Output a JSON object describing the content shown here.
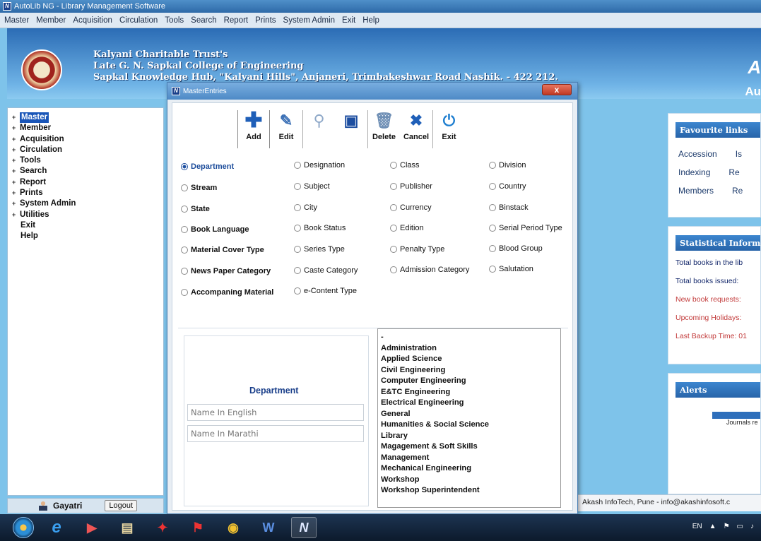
{
  "window": {
    "title": "AutoLib NG - Library Management Software"
  },
  "menu": [
    "Master",
    "Member",
    "Acquisition",
    "Circulation",
    "Tools",
    "Search",
    "Report",
    "Prints",
    "System Admin",
    "Exit",
    "Help"
  ],
  "banner": {
    "line1": "Kalyani Charitable Trust's",
    "line2": "Late G. N. Sapkal College of Engineering",
    "line3": "Sapkal Knowledge Hub, \"Kalyani Hills\", Anjaneri, Trimbakeshwar Road Nashik. - 422 212.",
    "brand_short": "A",
    "brand_text": "Au"
  },
  "sidebar": {
    "items": [
      {
        "label": "Master",
        "expand": "+"
      },
      {
        "label": "Member",
        "expand": "+"
      },
      {
        "label": "Acquisition",
        "expand": "+"
      },
      {
        "label": "Circulation",
        "expand": "+"
      },
      {
        "label": "Tools",
        "expand": "+"
      },
      {
        "label": "Search",
        "expand": "+"
      },
      {
        "label": "Report",
        "expand": "+"
      },
      {
        "label": "Prints",
        "expand": "+"
      },
      {
        "label": "System Admin",
        "expand": "+"
      },
      {
        "label": "Utilities",
        "expand": "+"
      },
      {
        "label": "Exit",
        "expand": ""
      },
      {
        "label": "Help",
        "expand": ""
      }
    ]
  },
  "user": {
    "name": "Gayatri",
    "logout_label": "Logout"
  },
  "dialog": {
    "title": "MasterEntries",
    "close": "x",
    "toolbar": {
      "add": "Add",
      "edit": "Edit",
      "delete": "Delete",
      "cancel": "Cancel",
      "exit": "Exit"
    },
    "radios": {
      "col1": [
        "Department",
        "Stream",
        "State",
        "Book Language",
        "Material Cover Type",
        "News Paper Category",
        "Accompaning Material"
      ],
      "col2": [
        "Designation",
        "Subject",
        "City",
        "Book Status",
        "Series Type",
        "Caste Category",
        "e-Content Type"
      ],
      "col3": [
        "Class",
        "Publisher",
        "Currency",
        "Edition",
        "Penalty Type",
        "Admission Category"
      ],
      "col4": [
        "Division",
        "Country",
        "Binstack",
        "Serial Period Type",
        "Blood Group",
        "Salutation"
      ]
    },
    "form": {
      "title": "Department",
      "name_english_placeholder": "Name In English",
      "name_marathi_placeholder": "Name In Marathi"
    },
    "list": [
      "-",
      "Administration",
      "Applied Science",
      "Civil Engineering",
      "Computer Engineering",
      "E&TC Engineering",
      "Electrical Engineering",
      "General",
      "Humanities & Social Science",
      "Library",
      "Magagement & Soft Skills",
      "Management",
      "Mechanical Engineering",
      "Workshop",
      "Workshop Superintendent"
    ]
  },
  "favourites": {
    "title": "Favourite links",
    "rows": [
      [
        "Accession",
        "Is"
      ],
      [
        "Indexing",
        "Re"
      ],
      [
        "Members",
        "Re"
      ]
    ]
  },
  "stats": {
    "title": "Statistical Informa",
    "lines": [
      "Total books in the lib",
      "Total books issued:",
      "New book requests:",
      "Upcoming Holidays:",
      "Last Backup Time: 01"
    ]
  },
  "alerts": {
    "title": "Alerts",
    "text": "Journals re"
  },
  "footer": {
    "text": "Akash InfoTech, Pune - info@akashinfosoft.c"
  },
  "taskbar": {
    "lang": "EN"
  }
}
